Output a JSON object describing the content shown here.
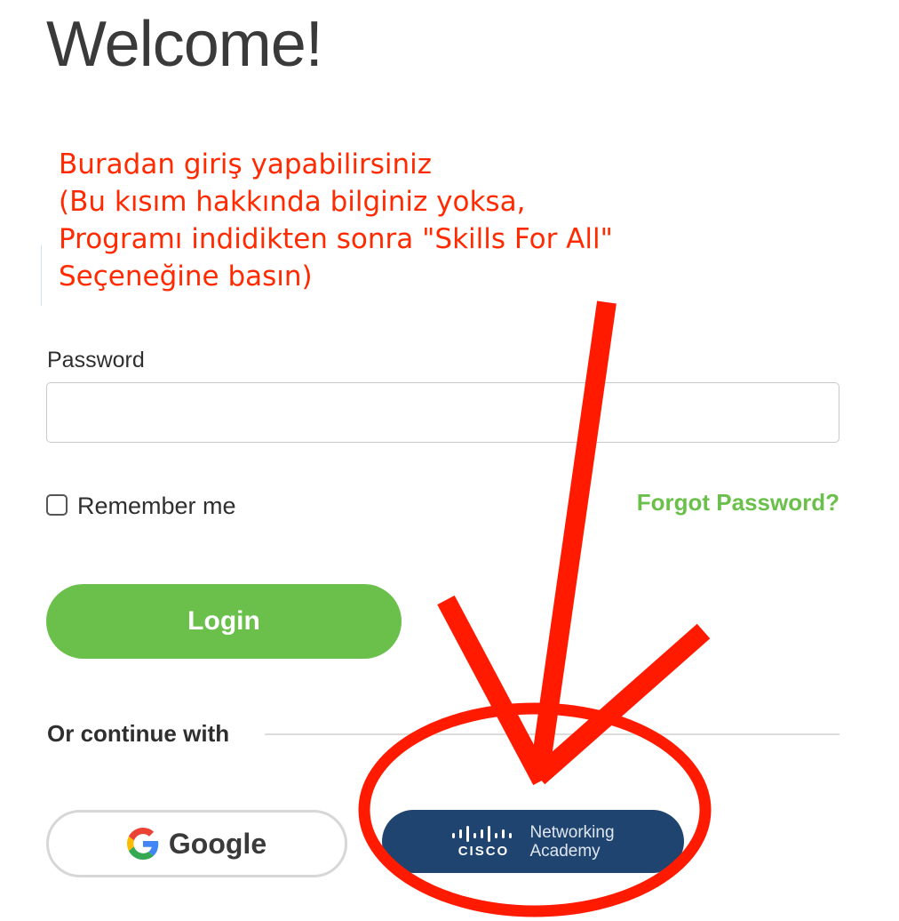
{
  "page": {
    "title": "Welcome!"
  },
  "annotation": {
    "lines": [
      "Buradan giriş yapabilirsiniz",
      "(Bu kısım hakkında bilginiz yoksa,",
      "Programı indidikten sonra \"Skills For All\"",
      "Seçeneğine basın)"
    ],
    "color": "#ff2a00"
  },
  "form": {
    "password_label": "Password",
    "password_value": "",
    "remember_label": "Remember me",
    "remember_checked": false,
    "forgot_label": "Forgot Password?",
    "login_label": "Login"
  },
  "alternatives": {
    "divider_text": "Or continue with",
    "google_label": "Google",
    "netacad": {
      "logo_word": "CISCO",
      "line1": "Networking",
      "line2": "Academy"
    }
  },
  "colors": {
    "accent_green": "#6bc04b",
    "netacad_blue": "#1f4470",
    "annotation_red": "#ff2a00"
  },
  "icons": [
    "google-icon",
    "cisco-logo-icon",
    "checkbox-icon"
  ]
}
